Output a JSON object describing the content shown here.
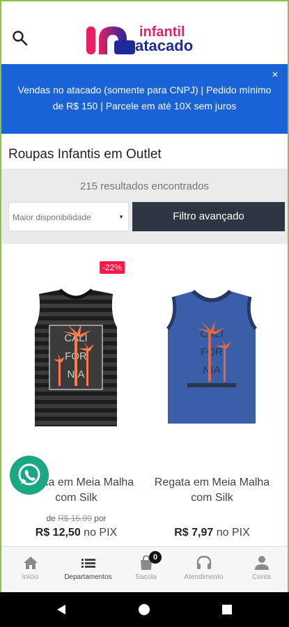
{
  "header": {
    "logo_line1": "infantil",
    "logo_line2": "atacado",
    "brand_pink": "#e91e63",
    "brand_blue": "#1e2a9c",
    "search_icon": "search-icon"
  },
  "banner": {
    "text": "Vendas no atacado (somente para CNPJ) |  Pedido mínimo de R$ 150 | Parcele em até 10X sem juros",
    "close": "×",
    "color": "#1a63d6"
  },
  "page": {
    "title": "Roupas Infantis em Outlet",
    "results": "215 resultados encontrados"
  },
  "controls": {
    "sort_value": "Maior disponibilidade",
    "filter_label": "Filtro avançado"
  },
  "products": [
    {
      "badge": "-22%",
      "name": "Regata em Meia Malha com Silk",
      "old_prefix": "de ",
      "old_price": "R$ 15,99",
      "old_suffix": " por",
      "price": "R$ 12,50",
      "price_suffix": " no PIX",
      "print_text": "CALI FOR NIA"
    },
    {
      "name": "Regata em Meia Malha com Silk",
      "price": "R$ 7,97",
      "price_suffix": " no PIX",
      "print_text": "CALI FOR NIA"
    }
  ],
  "bottom_nav": [
    {
      "label": "Início",
      "icon": "home-icon"
    },
    {
      "label": "Departamentos",
      "icon": "menu-icon"
    },
    {
      "label": "Sacola",
      "icon": "bag-icon",
      "badge": "0"
    },
    {
      "label": "Atendimento",
      "icon": "headset-icon"
    },
    {
      "label": "Conta",
      "icon": "user-icon"
    }
  ]
}
